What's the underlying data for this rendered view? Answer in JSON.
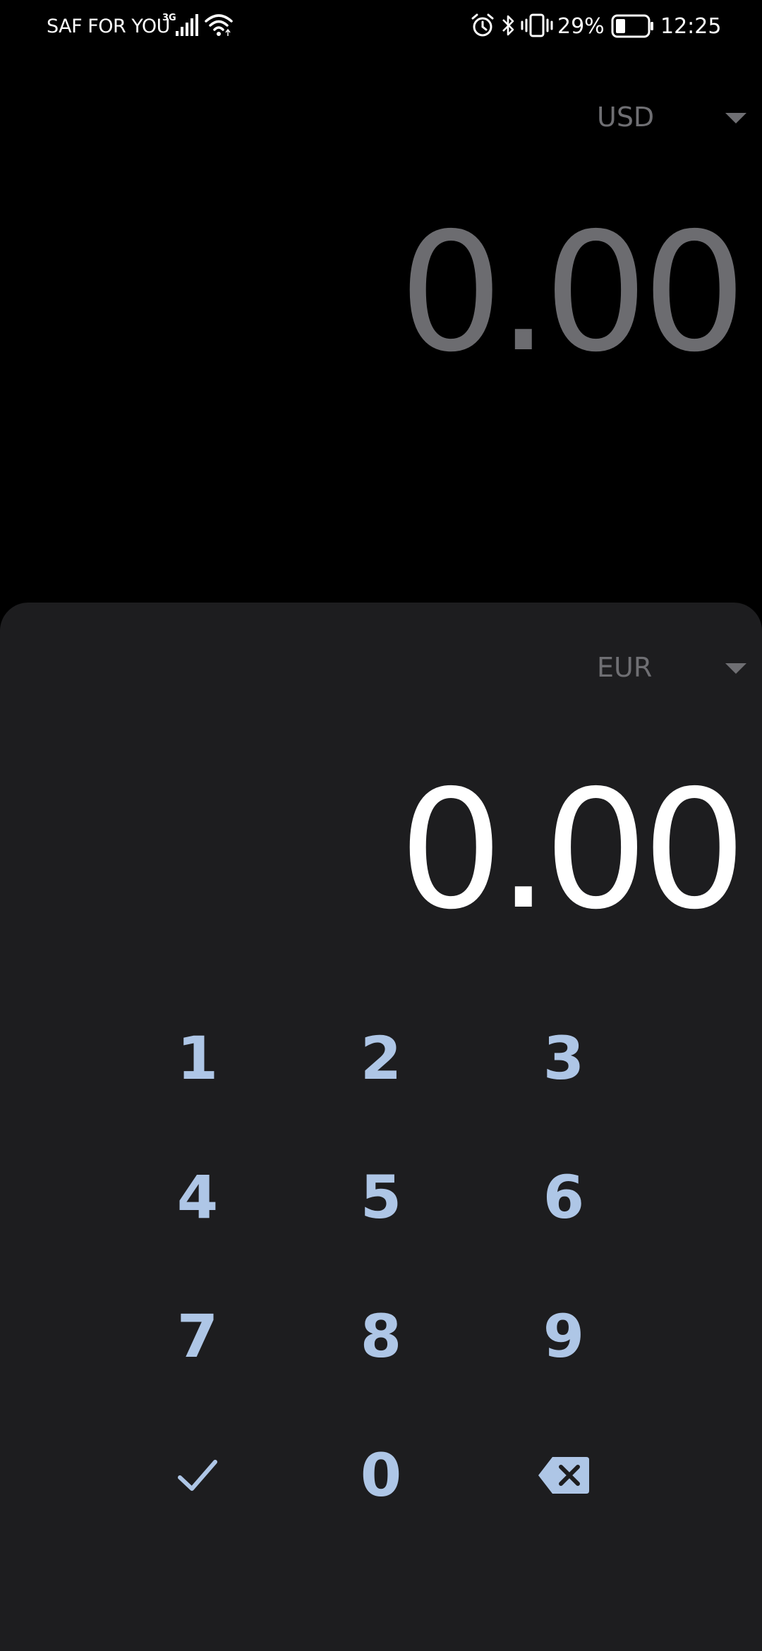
{
  "status_bar": {
    "carrier": "SAF FOR YOU",
    "network_type": "3G",
    "battery_percent": "29%",
    "time": "12:25",
    "icons": [
      "signal-icon",
      "wifi-icon",
      "alarm-icon",
      "bluetooth-icon",
      "vibrate-icon",
      "battery-icon"
    ]
  },
  "source": {
    "currency": "USD",
    "amount": "0.00"
  },
  "target": {
    "currency": "EUR",
    "amount": "0.00"
  },
  "keypad": {
    "keys": [
      "1",
      "2",
      "3",
      "4",
      "5",
      "6",
      "7",
      "8",
      "9",
      "✓",
      "0",
      "⌫"
    ],
    "confirm_icon": "check-icon",
    "backspace_icon": "backspace-icon"
  },
  "colors": {
    "background": "#000000",
    "sheet": "#1d1d1f",
    "key_text": "#aec6e6",
    "muted_text": "#6f6f73",
    "primary_text": "#ffffff"
  }
}
